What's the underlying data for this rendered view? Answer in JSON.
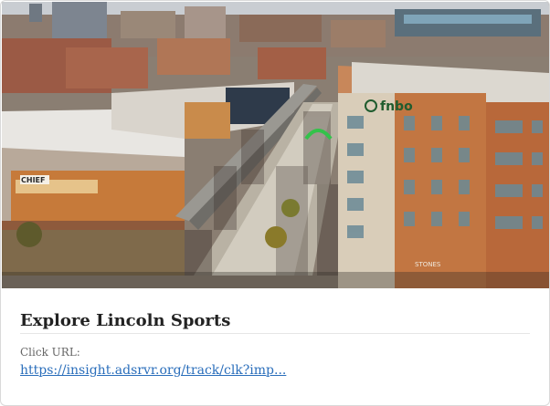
{
  "card": {
    "image_alt": "Aerial view of a crowd lining a street downtown for a race",
    "title": "Explore Lincoln Sports",
    "url_label": "Click URL:",
    "url_text": "https://insight.adsrvr.org/track/clk?imp..."
  },
  "photo_signage": {
    "bank_sign": "fnbo",
    "chief_sign": "CHIEF",
    "stones_sign": "STONES"
  },
  "colors": {
    "title": "#222222",
    "link": "#2a6ebb",
    "label": "#666666"
  }
}
